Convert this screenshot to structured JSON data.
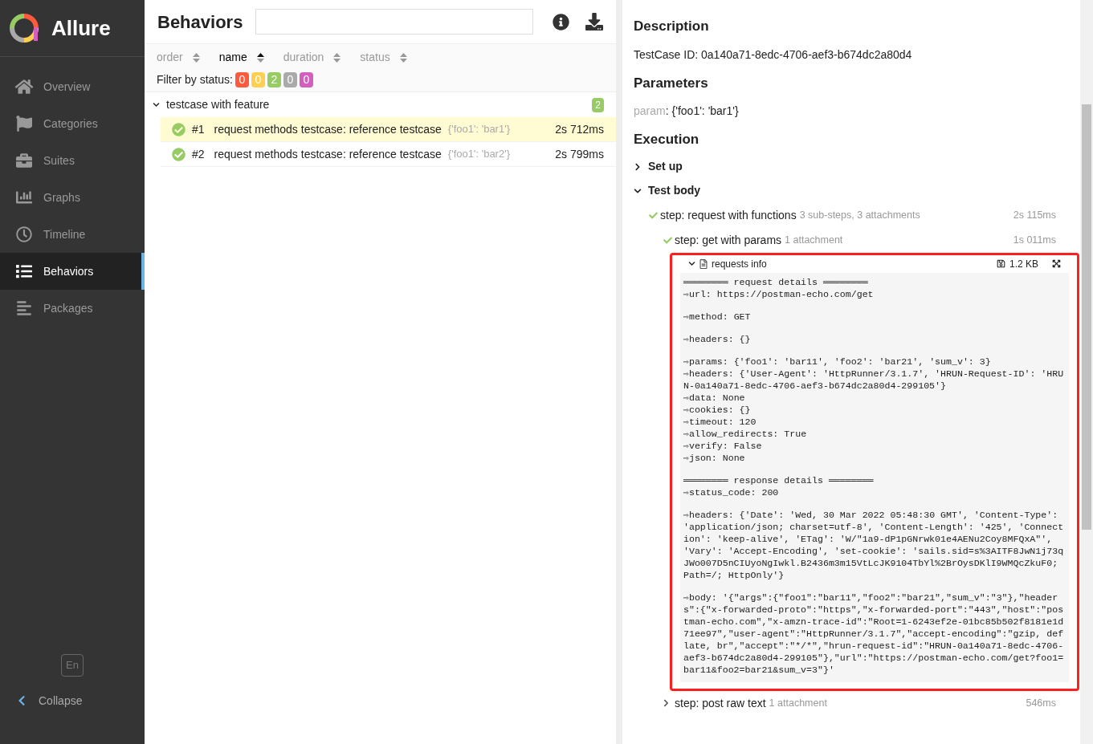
{
  "app": {
    "name": "Allure"
  },
  "sidebar": {
    "items": [
      {
        "label": "Overview",
        "selected": false
      },
      {
        "label": "Categories",
        "selected": false
      },
      {
        "label": "Suites",
        "selected": false
      },
      {
        "label": "Graphs",
        "selected": false
      },
      {
        "label": "Timeline",
        "selected": false
      },
      {
        "label": "Behaviors",
        "selected": true
      },
      {
        "label": "Packages",
        "selected": false
      }
    ],
    "language": "En",
    "collapse": "Collapse"
  },
  "tree_panel": {
    "title": "Behaviors",
    "sort_columns": [
      {
        "label": "order",
        "selected": false
      },
      {
        "label": "name",
        "selected": true
      },
      {
        "label": "duration",
        "selected": false
      },
      {
        "label": "status",
        "selected": false
      }
    ],
    "filter_label": "Filter by status:",
    "filters": [
      {
        "count": "0",
        "color": "#fd5a3e"
      },
      {
        "count": "0",
        "color": "#ffd050"
      },
      {
        "count": "2",
        "color": "#97cc64"
      },
      {
        "count": "0",
        "color": "#aaaaaa"
      },
      {
        "count": "0",
        "color": "#d35ebe"
      }
    ],
    "groups": [
      {
        "name": "testcase with feature",
        "count": "2",
        "expanded": true,
        "children": [
          {
            "number": "#1",
            "name": "request methods testcase: reference testcase",
            "params": "{'foo1': 'bar1'}",
            "duration": "2s 712ms",
            "selected": true
          },
          {
            "number": "#2",
            "name": "request methods testcase: reference testcase",
            "params": "{'foo1': 'bar2'}",
            "duration": "2s 799ms",
            "selected": false
          }
        ]
      }
    ]
  },
  "details": {
    "description_title": "Description",
    "description": "TestCase ID: 0a140a71-8edc-4706-aef3-b674dc2a80d4",
    "parameters_title": "Parameters",
    "parameters": [
      {
        "name": "param",
        "separator": ":",
        "value": "{'foo1': 'bar1'}"
      }
    ],
    "execution_title": "Execution",
    "stages": [
      {
        "name": "Set up",
        "expanded": false
      },
      {
        "name": "Test body",
        "expanded": true
      }
    ],
    "steps": [
      {
        "name": "step: request with functions",
        "meta": "3 sub-steps, 3 attachments",
        "duration": "2s 115ms",
        "expanded": true,
        "children": [
          {
            "name": "step: get with params",
            "meta": "1 attachment",
            "duration": "1s 011ms",
            "expanded": true,
            "attachment": {
              "name": "requests info",
              "size": "1.2 KB",
              "expanded": true,
              "log": [
                "════════ request details ════════\n⇨url: https://postman-echo.com/get",
                "⇨method: GET",
                "⇨headers: {}",
                "⇨params: {'foo1': 'bar11', 'foo2': 'bar21', 'sum_v': 3}\n⇨headers: {'User-Agent': 'HttpRunner/3.1.7', 'HRUN-Request-ID': 'HRUN-0a140a71-8edc-4706-aef3-b674dc2a80d4-299105'}\n⇨data: None\n⇨cookies: {}\n⇨timeout: 120\n⇨allow_redirects: True\n⇨verify: False\n⇨json: None",
                "════════ response details ════════\n⇨status_code: 200",
                "⇨headers: {'Date': 'Wed, 30 Mar 2022 05:48:30 GMT', 'Content-Type': 'application/json; charset=utf-8', 'Content-Length': '425', 'Connection': 'keep-alive', 'ETag': 'W/\"1a9-dP1pGNrwk01e4AENu2Coy8MFQxA\"', 'Vary': 'Accept-Encoding', 'set-cookie': 'sails.sid=s%3AITF8JwN1j73qJWo007D5nCIUyoNgIwkl.B2436m3m15VtLcJK9104TbYl%2BrOysDKlI9WMQcZkuF0; Path=/; HttpOnly'}",
                "⇨body: '{\"args\":{\"foo1\":\"bar11\",\"foo2\":\"bar21\",\"sum_v\":\"3\"},\"headers\":{\"x-forwarded-proto\":\"https\",\"x-forwarded-port\":\"443\",\"host\":\"postman-echo.com\",\"x-amzn-trace-id\":\"Root=1-6243ef2e-01bc85b502f8181e1d71ee97\",\"user-agent\":\"HttpRunner/3.1.7\",\"accept-encoding\":\"gzip, deflate, br\",\"accept\":\"*/*\",\"hrun-request-id\":\"HRUN-0a140a71-8edc-4706-aef3-b674dc2a80d4-299105\"},\"url\":\"https://postman-echo.com/get?foo1=bar11&foo2=bar21&sum_v=3\"}'"
              ]
            }
          },
          {
            "name": "step: post raw text",
            "meta": "1 attachment",
            "duration": "546ms",
            "expanded": false
          }
        ]
      }
    ]
  }
}
